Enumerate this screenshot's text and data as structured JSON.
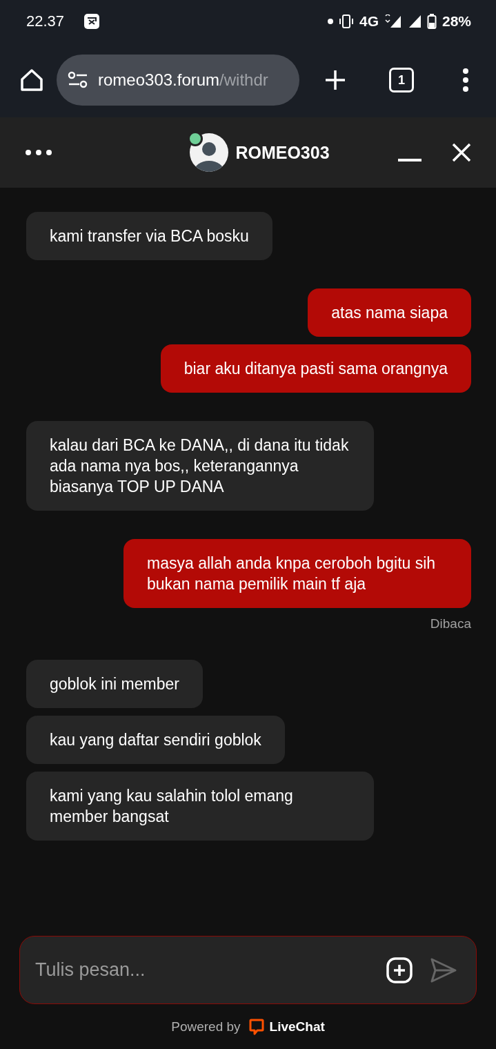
{
  "status_bar": {
    "time": "22.37",
    "network": "4G",
    "battery": "28%"
  },
  "browser": {
    "url_host": "romeo303.forum",
    "url_path": "/withdr",
    "tab_count": "1"
  },
  "chat_header": {
    "agent_name": "ROMEO303",
    "online": true
  },
  "groups": [
    {
      "kind": "agent",
      "messages": [
        "kami transfer via BCA bosku"
      ]
    },
    {
      "kind": "visitor",
      "messages": [
        "atas nama siapa",
        "biar aku ditanya pasti sama orangnya"
      ]
    },
    {
      "kind": "agent",
      "messages": [
        "kalau dari BCA ke DANA,, di dana itu tidak ada nama nya bos,, keterangannya biasanya TOP UP DANA"
      ]
    },
    {
      "kind": "visitor",
      "messages": [
        "masya allah anda knpa ceroboh bgitu sih bukan nama pemilik main tf aja"
      ],
      "status": "Dibaca"
    },
    {
      "kind": "agent",
      "messages": [
        "goblok ini member",
        "kau yang daftar sendiri goblok",
        "kami yang kau salahin tolol emang member bangsat"
      ]
    }
  ],
  "composer": {
    "placeholder": "Tulis pesan..."
  },
  "footer": {
    "powered_by": "Powered by",
    "brand": "LiveChat"
  }
}
